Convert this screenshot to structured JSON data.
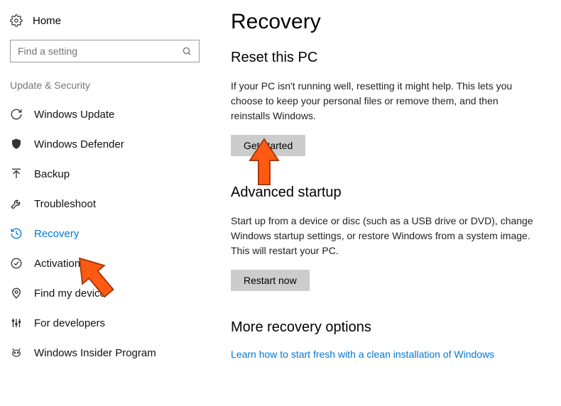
{
  "sidebar": {
    "home_label": "Home",
    "search_placeholder": "Find a setting",
    "category_label": "Update & Security",
    "items": [
      {
        "label": "Windows Update"
      },
      {
        "label": "Windows Defender"
      },
      {
        "label": "Backup"
      },
      {
        "label": "Troubleshoot"
      },
      {
        "label": "Recovery"
      },
      {
        "label": "Activation"
      },
      {
        "label": "Find my device"
      },
      {
        "label": "For developers"
      },
      {
        "label": "Windows Insider Program"
      }
    ]
  },
  "main": {
    "title": "Recovery",
    "reset": {
      "heading": "Reset this PC",
      "body": "If your PC isn't running well, resetting it might help. This lets you choose to keep your personal files or remove them, and then reinstalls Windows.",
      "button": "Get started"
    },
    "advanced": {
      "heading": "Advanced startup",
      "body": "Start up from a device or disc (such as a USB drive or DVD), change Windows startup settings, or restore Windows from a system image. This will restart your PC.",
      "button": "Restart now"
    },
    "more": {
      "heading": "More recovery options",
      "link": "Learn how to start fresh with a clean installation of Windows"
    }
  }
}
